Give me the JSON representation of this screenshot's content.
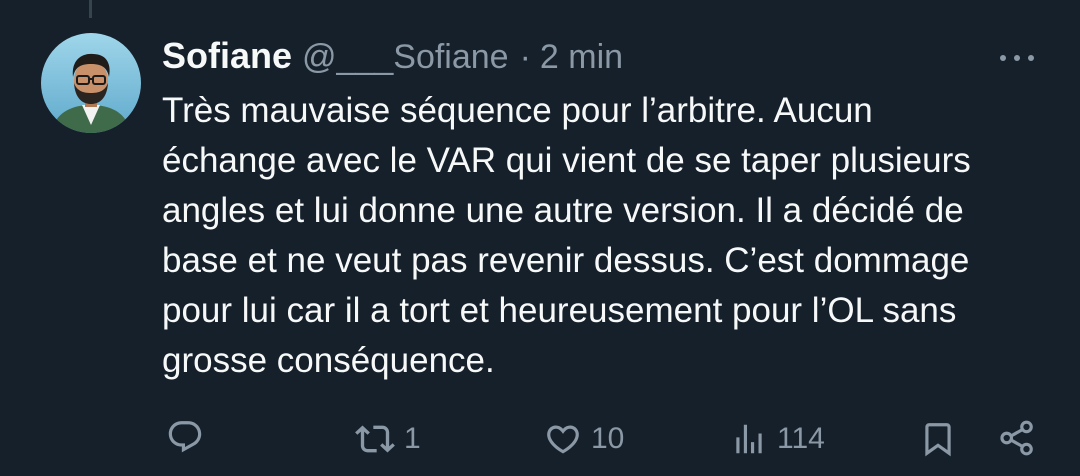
{
  "theme": {
    "background": "#15202b",
    "text": "#f7f9f9",
    "muted": "#8b98a5",
    "thread_line": "#38444d"
  },
  "tweet": {
    "author_name": "Sofiane",
    "handle": "@___Sofiane",
    "separator": "·",
    "time": "2 min",
    "avatar_icon": "profile-avatar",
    "more_icon": "more-dots-icon",
    "text_lines": [
      "Très mauvaise séquence pour l’arbitre. Aucun",
      "échange avec le VAR qui vient de se taper plusieurs",
      "angles et lui donne une autre version. Il a décidé de",
      "base et ne veut pas revenir dessus. C’est dommage",
      "pour lui car il a tort et heureusement pour l’OL sans",
      "grosse conséquence."
    ]
  },
  "actions": {
    "reply": {
      "icon": "reply-icon"
    },
    "repost": {
      "icon": "repost-icon",
      "count": "1"
    },
    "like": {
      "icon": "heart-icon",
      "count": "10"
    },
    "views": {
      "icon": "views-icon",
      "count": "114"
    },
    "bookmark": {
      "icon": "bookmark-icon"
    },
    "share": {
      "icon": "share-icon"
    }
  }
}
